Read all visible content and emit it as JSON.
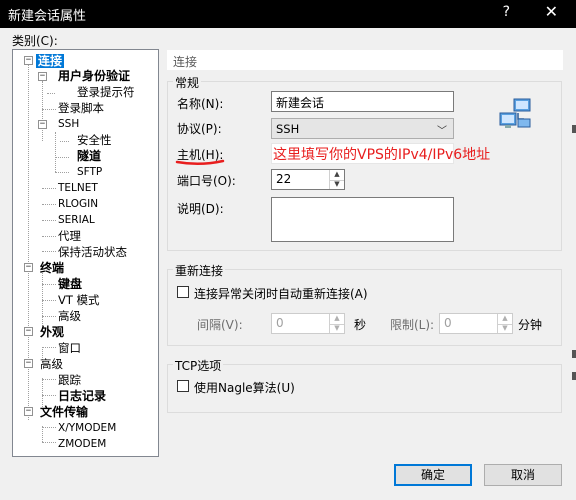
{
  "window": {
    "title": "新建会话属性",
    "help_glyph": "?",
    "close_glyph": "✕"
  },
  "category_label": "类别(C):",
  "tree": {
    "items": [
      {
        "label": "连接",
        "expander": "−"
      },
      {
        "label": "用户身份验证",
        "expander": "−"
      },
      {
        "label": "登录提示符"
      },
      {
        "label": "登录脚本"
      },
      {
        "label": "SSH",
        "expander": "−"
      },
      {
        "label": "安全性"
      },
      {
        "label": "隧道"
      },
      {
        "label": "SFTP"
      },
      {
        "label": "TELNET"
      },
      {
        "label": "RLOGIN"
      },
      {
        "label": "SERIAL"
      },
      {
        "label": "代理"
      },
      {
        "label": "保持活动状态"
      },
      {
        "label": "终端",
        "expander": "−"
      },
      {
        "label": "键盘"
      },
      {
        "label": "VT 模式"
      },
      {
        "label": "高级"
      },
      {
        "label": "外观",
        "expander": "−"
      },
      {
        "label": "窗口"
      },
      {
        "label": "高级",
        "expander": "−"
      },
      {
        "label": "跟踪"
      },
      {
        "label": "日志记录"
      },
      {
        "label": "文件传输",
        "expander": "−"
      },
      {
        "label": "X/YMODEM"
      },
      {
        "label": "ZMODEM"
      }
    ]
  },
  "panel": {
    "header": "连接",
    "general": {
      "title": "常规",
      "name_label": "名称(N):",
      "name_value": "新建会话",
      "protocol_label": "协议(P):",
      "protocol_value": "SSH",
      "host_label": "主机(H):",
      "host_value": "",
      "port_label": "端口号(O):",
      "port_value": "22",
      "desc_label": "说明(D):",
      "desc_value": ""
    },
    "reconnect": {
      "title": "重新连接",
      "checkbox_label": "连接异常关闭时自动重新连接(A)",
      "interval_label": "间隔(V):",
      "interval_value": "0",
      "interval_unit": "秒",
      "limit_label": "限制(L):",
      "limit_value": "0",
      "limit_unit": "分钟"
    },
    "tcp": {
      "title": "TCP选项",
      "nagle_label": "使用Nagle算法(U)"
    }
  },
  "annotation": "这里填写你的VPS的IPv4/IPv6地址",
  "buttons": {
    "ok": "确定",
    "cancel": "取消"
  },
  "colors": {
    "accent": "#0078d7",
    "annotation": "#e81e1e"
  }
}
